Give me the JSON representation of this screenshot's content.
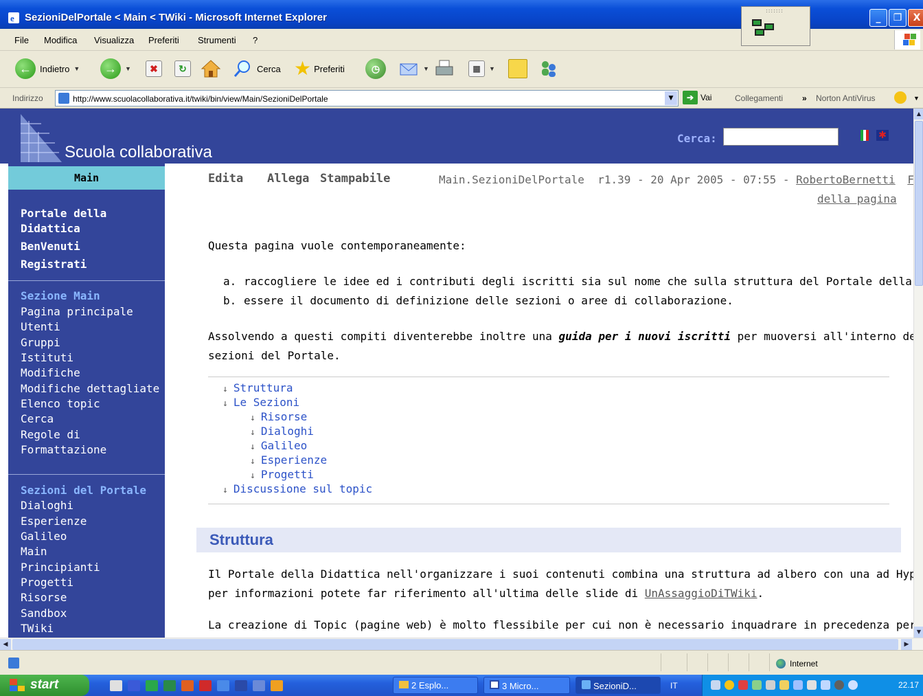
{
  "window": {
    "title": "SezioniDelPortale < Main < TWiki - Microsoft Internet Explorer",
    "minimize": "_",
    "maximize": "❐",
    "close": "X"
  },
  "menu": [
    "File",
    "Modifica",
    "Visualizza",
    "Preferiti",
    "Strumenti",
    "?"
  ],
  "toolbar": {
    "back": "Indietro",
    "search": "Cerca",
    "favorites": "Preferiti"
  },
  "address": {
    "label": "Indirizzo",
    "url": "http://www.scuolacollaborativa.it/twiki/bin/view/Main/SezioniDelPortale",
    "go": "Vai",
    "links": "Collegamenti",
    "norton": "Norton AntiVirus"
  },
  "site": {
    "logo": "Scuola collaborativa",
    "search_label": "Cerca:"
  },
  "sidebar": {
    "web": "Main",
    "top_links": [
      "Portale della",
      "Didattica",
      "BenVenuti",
      "Registrati"
    ],
    "section1_title": "Sezione Main",
    "section1_links": [
      "Pagina principale",
      "Utenti",
      "Gruppi",
      "Istituti",
      "Modifiche",
      "Modifiche dettagliate",
      "Elenco topic",
      "Cerca",
      "Regole di",
      "Formattazione"
    ],
    "section2_title": "Sezioni del Portale",
    "section2_links": [
      "Dialoghi",
      "Esperienze",
      "Galileo",
      "Main",
      "Principianti",
      "Progetti",
      "Risorse",
      "Sandbox",
      "TWiki"
    ]
  },
  "topic": {
    "actions": [
      "Edita",
      "Allega",
      "Stampabile"
    ],
    "meta_prefix": "Main.SezioniDelPortale  r1.39 - 20 Apr 2005 - 07:55 - ",
    "author": "RobertoBernetti",
    "end_link_1": "Fine",
    "end_link_2": "della pagina",
    "intro": "Questa pagina vuole contemporaneamente:",
    "list": [
      {
        "marker": "a.",
        "text": "raccogliere le idee ed i contributi degli iscritti sia sul nome che sulla struttura del Portale della Didattica"
      },
      {
        "marker": "b.",
        "text": "essere il documento di definizione delle sezioni o aree di collaborazione."
      }
    ],
    "para1_a": "Assolvendo a questi compiti diventerebbe inoltre una ",
    "para1_em": "guida per i nuovi iscritti",
    "para1_b": " per muoversi all'interno delle varie",
    "para1_line2": "sezioni del Portale.",
    "toc": [
      {
        "label": "Struttura",
        "level": 1
      },
      {
        "label": "Le Sezioni",
        "level": 1
      },
      {
        "label": "Risorse",
        "level": 2
      },
      {
        "label": "Dialoghi",
        "level": 2
      },
      {
        "label": "Galileo",
        "level": 2
      },
      {
        "label": "Esperienze",
        "level": 2
      },
      {
        "label": "Progetti",
        "level": 2
      },
      {
        "label": "Discussione sul topic",
        "level": 1
      }
    ],
    "toc_arrow": "↓",
    "heading": "Struttura",
    "para2_line1": "Il Portale della Didattica nell'organizzare i suoi contenuti combina una struttura ad albero con una ad Hyperlink.",
    "para2_line2a": "per informazioni potete far riferimento all'ultima delle slide di ",
    "para2_link": "UnAssaggioDiTWiki",
    "para2_line2b": ".",
    "para3": "La creazione di Topic (pagine web) è molto flessibile per cui non è necessario inquadrare in precedenza per"
  },
  "status": {
    "zone": "Internet"
  },
  "taskbar": {
    "start": "start",
    "tasks": [
      "2 Esplo...",
      "3 Micro...",
      "SezioniD..."
    ],
    "lang": "IT",
    "clock": "22.17"
  },
  "colors": {
    "header_bg": "#33459a",
    "sidebar_bg": "#33459a",
    "web_tab": "#73cbda",
    "link": "#2c52c8",
    "heading": "#3b5ab8"
  }
}
